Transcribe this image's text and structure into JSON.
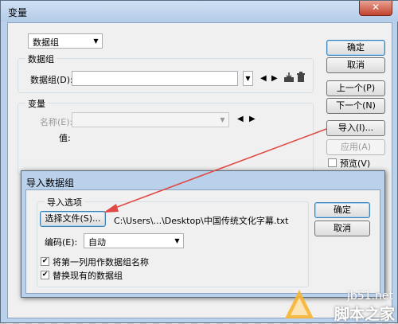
{
  "window": {
    "title": "变量",
    "close_glyph": "✕"
  },
  "side_buttons": {
    "ok": "确定",
    "cancel": "取消",
    "previous": "上一个(P)",
    "next": "下一个(N)",
    "import": "导入(I)...",
    "apply": "应用(A)",
    "preview": "预览(V)"
  },
  "top_select": {
    "value": "数据组"
  },
  "data_set_group": {
    "legend": "数据组",
    "label": "数据组(D):",
    "value": ""
  },
  "variable_group": {
    "legend": "变量",
    "name_label": "名称(E):",
    "name_value": "",
    "value_label": "值:"
  },
  "import_dialog": {
    "title": "导入数据组",
    "options_legend": "导入选项",
    "choose_file_button": "选择文件(S)...",
    "file_path": "C:\\Users\\...\\Desktop\\中国传统文化字幕.txt",
    "encoding_label": "编码(E):",
    "encoding_value": "自动",
    "checkbox_first_column": "将第一列用作数据组名称",
    "checkbox_replace": "替换现有的数据组",
    "first_column_checked": true,
    "replace_checked": true,
    "ok": "确定",
    "cancel": "取消"
  },
  "watermark": {
    "site": "jb51.net",
    "name": "脚本之家"
  },
  "colors": {
    "annotation_arrow": "#e04a46",
    "title_bar": "#b9d1ea",
    "client_bg": "#f0f0f0"
  }
}
